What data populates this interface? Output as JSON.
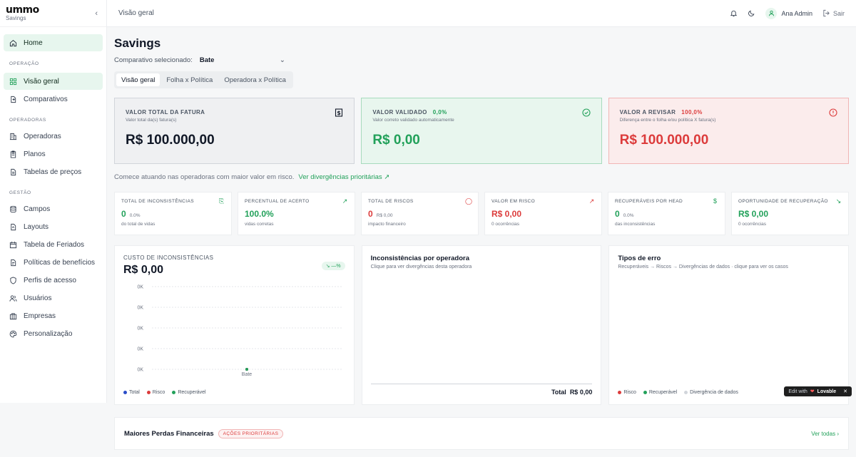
{
  "app": {
    "logo": "ummo",
    "logo_sub": "Savings"
  },
  "sidebar": {
    "home": "Home",
    "sections": [
      {
        "label": "OPERAÇÃO",
        "items": [
          "Visão geral",
          "Comparativos"
        ]
      },
      {
        "label": "OPERADORAS",
        "items": [
          "Operadoras",
          "Planos",
          "Tabelas de preços"
        ]
      },
      {
        "label": "GESTÃO",
        "items": [
          "Campos",
          "Layouts",
          "Tabela de Feriados",
          "Políticas de benefícios",
          "Perfis de acesso",
          "Usuários",
          "Empresas",
          "Personalização"
        ]
      }
    ]
  },
  "topbar": {
    "breadcrumb": "Visão geral",
    "user": "Ana Admin",
    "logout": "Sair"
  },
  "page": {
    "title": "Savings",
    "compare_label": "Comparativo selecionado:",
    "compare_value": "Bate",
    "tabs": [
      "Visão geral",
      "Folha x Política",
      "Operadora x Política"
    ]
  },
  "kpis": [
    {
      "label": "VALOR TOTAL DA FATURA",
      "pct": "",
      "sub": "Valor total da(s) fatura(s)",
      "value": "R$ 100.000,00"
    },
    {
      "label": "VALOR VALIDADO",
      "pct": "0,0%",
      "sub": "Valor correto validado automaticamente",
      "value": "R$ 0,00"
    },
    {
      "label": "VALOR A REVISAR",
      "pct": "100,0%",
      "sub": "Diferença entre o folha e/ou política X fatura(s)",
      "value": "R$ 100.000,00"
    }
  ],
  "hint": {
    "text": "Comece atuando nas operadoras com maior valor em risco.",
    "link": "Ver divergências prioritárias ↗"
  },
  "minis": [
    {
      "label": "TOTAL DE INCONSISTÊNCIAS",
      "value": "0",
      "small": "0.0%",
      "cap": "do total de vidas"
    },
    {
      "label": "PERCENTUAL DE ACERTO",
      "value": "100.0%",
      "small": "",
      "cap": "vidas corretas"
    },
    {
      "label": "TOTAL DE RISCOS",
      "value": "0",
      "small": "R$ 0,00",
      "cap": "impacto financeiro"
    },
    {
      "label": "VALOR EM RISCO",
      "value": "R$ 0,00",
      "small": "",
      "cap": "0 ocorrências"
    },
    {
      "label": "RECUPERÁVEIS POR HEAD",
      "value": "0",
      "small": "0.0%",
      "cap": "das inconsistências"
    },
    {
      "label": "OPORTUNIDADE DE RECUPERAÇÃO",
      "value": "R$ 0,00",
      "small": "",
      "cap": "0 ocorrências"
    }
  ],
  "cost_card": {
    "label": "CUSTO DE INCONSISTÊNCIAS",
    "value": "R$ 0,00",
    "trend": "↘ —%",
    "y_ticks": [
      "0K",
      "0K",
      "0K",
      "0K",
      "0K"
    ],
    "legend": [
      "Total",
      "Risco",
      "Recuperável"
    ]
  },
  "chart_data": {
    "type": "line",
    "categories": [
      "Bate"
    ],
    "series": [
      {
        "name": "Total",
        "values": [
          0
        ]
      },
      {
        "name": "Risco",
        "values": [
          0
        ]
      },
      {
        "name": "Recuperável",
        "values": [
          0
        ]
      }
    ],
    "title": "CUSTO DE INCONSISTÊNCIAS",
    "xlabel": "",
    "ylabel": "",
    "ytick_labels": [
      "0K",
      "0K",
      "0K",
      "0K",
      "0K"
    ],
    "grid": true,
    "legend": "bottom-left"
  },
  "operator_card": {
    "title": "Inconsistências por operadora",
    "sub": "Clique para ver divergências desta operadora",
    "total_label": "Total",
    "total_value": "R$ 0,00"
  },
  "errors_card": {
    "title": "Tipos de erro",
    "sub": "Recuperáveis → Riscos → Divergências de dados · clique para ver os casos",
    "legend": [
      "Risco",
      "Recuperável",
      "Divergência de dados"
    ]
  },
  "bottom": {
    "title": "Maiores Perdas Financeiras",
    "pill": "AÇÕES PRIORITÁRIAS",
    "see_all": "Ver todas"
  },
  "badge": {
    "prefix": "Edit with",
    "brand": "Lovable"
  },
  "colors": {
    "accent": "#22a15a",
    "danger": "#dc3b3b",
    "total": "#2a4dc8"
  }
}
